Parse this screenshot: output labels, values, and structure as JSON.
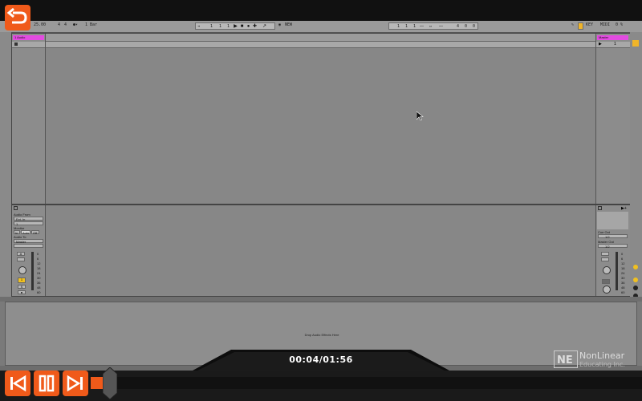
{
  "control_bar": {
    "tempo": "25.00",
    "signature_num": "4",
    "signature_den": "4",
    "quantize": "1 Bar",
    "position": [
      "1",
      "1",
      "1"
    ],
    "new_label": "NEW",
    "loop_start": [
      "1",
      "1",
      "1"
    ],
    "loop_length": [
      "4",
      "0",
      "0"
    ],
    "key_label": "KEY",
    "midi_label": "MIDI",
    "cpu": "0 %"
  },
  "arrangement": {
    "track_name": "1 Audio",
    "master_name": "Master",
    "master_clip": "1"
  },
  "mixer_left": {
    "audio_from_label": "Audio From",
    "audio_from_value": "Ext. In",
    "input_channel": "1",
    "monitor_label": "Monitor",
    "monitor_options": [
      "In",
      "Auto",
      "Off"
    ],
    "audio_to_label": "Audio To",
    "audio_to_value": "Master",
    "send_a": "A",
    "track_number": "1",
    "solo": "S",
    "db_scale": [
      "0",
      "6",
      "12",
      "18",
      "24",
      "30",
      "36",
      "48",
      "60"
    ]
  },
  "mixer_right": {
    "cue_out_label": "Cue Out",
    "cue_out_value": "1/2",
    "master_out_label": "Master Out",
    "master_out_value": "1/2",
    "db_scale": [
      "0",
      "6",
      "12",
      "18",
      "24",
      "30",
      "36",
      "48",
      "60"
    ]
  },
  "device_area": {
    "drop_text": "Drop Audio Effects Here"
  },
  "player": {
    "time": "00:04/01:56",
    "progress": 0.035
  },
  "brand": {
    "logo_letters": "NE",
    "name": "NonLinear",
    "sub": "Educating Inc."
  },
  "colors": {
    "accent": "#f05a1a",
    "track_color": "#e24be0"
  }
}
